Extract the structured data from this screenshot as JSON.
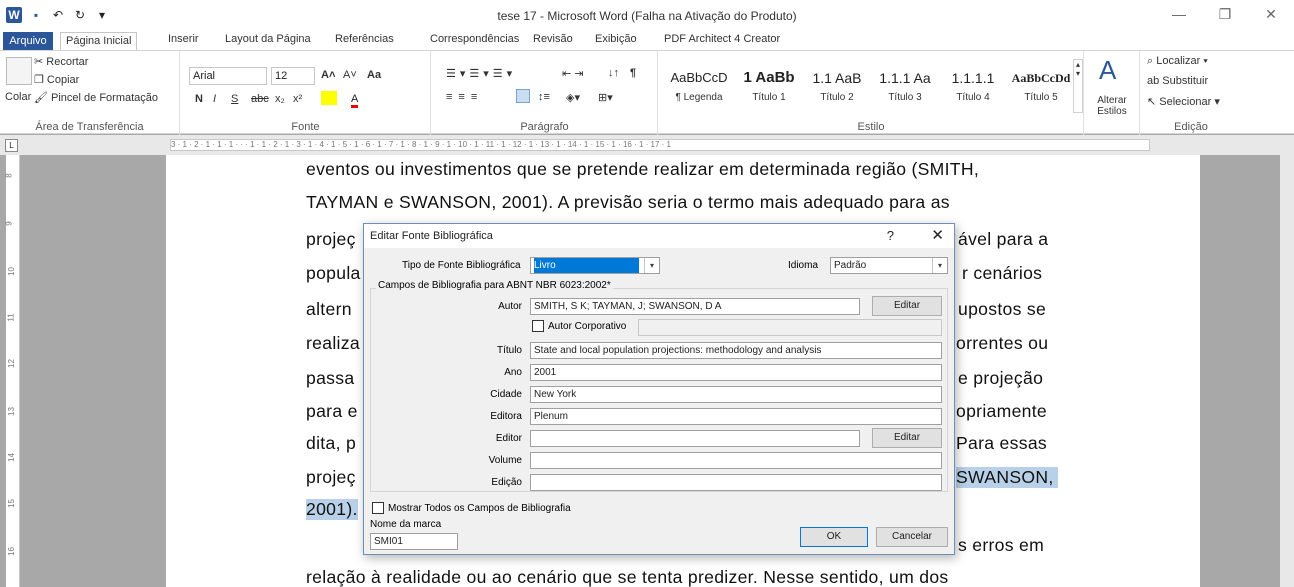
{
  "window": {
    "title": "tese 17 - Microsoft Word (Falha na Ativação do Produto)",
    "minimize": "—",
    "restore": "❐",
    "close": "✕"
  },
  "qat": {
    "word_icon": "W",
    "save_icon": "💾",
    "undo_icon": "↶",
    "redo_icon": "↻",
    "customize_icon": "▾"
  },
  "tabs": {
    "file": "Arquivo",
    "items": [
      "Página Inicial",
      "Inserir",
      "Layout da Página",
      "Referências",
      "Correspondências",
      "Revisão",
      "Exibição",
      "PDF Architect 4 Creator"
    ]
  },
  "ribbon": {
    "clipboard": {
      "paste": "Colar",
      "cut": "Recortar",
      "copy": "Copiar",
      "format_painter": "Pincel de Formatação",
      "label": "Área de Transferência"
    },
    "font": {
      "name": "Arial",
      "size": "12",
      "label": "Fonte",
      "bold": "N",
      "italic": "I",
      "underline": "S",
      "strike": "abc",
      "sub": "x₂",
      "sup": "x²",
      "grow": "A˄",
      "shrink": "A˅",
      "case": "Aa",
      "color": "A"
    },
    "paragraph": {
      "label": "Parágrafo",
      "pilcrow": "¶"
    },
    "styles": {
      "label": "Estilo",
      "items": [
        {
          "sample": "AaBbCcD",
          "name": "¶ Legenda"
        },
        {
          "sample": "1 AaBb",
          "name": "Título 1"
        },
        {
          "sample": "1.1 AaB",
          "name": "Título 2"
        },
        {
          "sample": "1.1.1 Aa",
          "name": "Título 3"
        },
        {
          "sample": "1.1.1.1",
          "name": "Título 4"
        },
        {
          "sample": "AaBbCcDd",
          "name": "Título 5"
        }
      ],
      "change": "Alterar Estilos"
    },
    "editing": {
      "find": "Localizar",
      "replace": "Substituir",
      "select": "Selecionar",
      "label": "Edição"
    }
  },
  "ruler": {
    "h_text": "3 · 1 · 2 · 1 · 1 · 1 · · · 1 · 1 · 2 · 1 · 3 · 1 · 4 · 1 · 5 · 1 · 6 · 1 · 7 · 1 · 8 · 1 · 9 · 1 · 10 · 1 · 11 · 1 · 12 · 1 · 13 · 1 · 14 · 1 · 15 · 1 · 16 · 1 · 17 · 1",
    "v_marks": [
      "8",
      "9",
      "10",
      "11",
      "12",
      "13",
      "14",
      "15",
      "16"
    ],
    "corner": "L"
  },
  "document": {
    "lines": [
      "eventos ou investimentos que se pretende realizar em determinada região (SMITH,",
      "TAYMAN e SWANSON, 2001). A previsão seria o termo mais adequado para as",
      "projeç",
      "popula",
      "altern",
      "realiza",
      "passa",
      "para e",
      "dita, p",
      "projeç",
      "2001).",
      "",
      "relação à realidade ou ao cenário que se tenta predizer. Nesse sentido, um dos"
    ],
    "right_fragments": [
      "ável para a",
      "r cenários",
      "upostos se",
      "orrentes ou",
      "e projeção",
      "opriamente",
      "Para essas",
      "SWANSON,",
      "",
      "s erros em"
    ]
  },
  "dialog": {
    "title": "Editar Fonte Bibliográfica",
    "help": "?",
    "close": "✕",
    "source_type_label": "Tipo de Fonte Bibliográfica",
    "source_type_value": "Livro",
    "language_label": "Idioma",
    "language_value": "Padrão",
    "fields_header": "Campos de Bibliografia para ABNT NBR 6023:2002*",
    "author_label": "Autor",
    "author_value": "SMITH, S K; TAYMAN, J; SWANSON, D A",
    "edit_label": "Editar",
    "corporate_author_label": "Autor Corporativo",
    "title_label": "Título",
    "title_value": "State and local population projections: methodology and analysis",
    "year_label": "Ano",
    "year_value": "2001",
    "city_label": "Cidade",
    "city_value": "New York",
    "publisher_label": "Editora",
    "publisher_value": "Plenum",
    "editor_label": "Editor",
    "editor_value": "",
    "volume_label": "Volume",
    "volume_value": "",
    "edition_label": "Edição",
    "edition_value": "",
    "show_all_label": "Mostrar Todos os Campos de Bibliografia",
    "tag_name_label": "Nome da marca",
    "tag_name_value": "SMI01",
    "ok": "OK",
    "cancel": "Cancelar"
  }
}
